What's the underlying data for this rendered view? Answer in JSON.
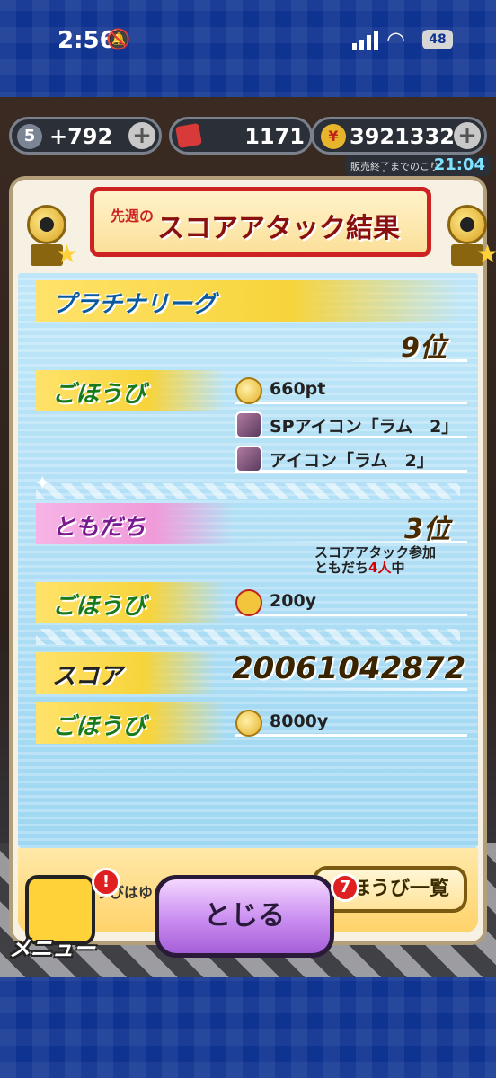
{
  "status_bar": {
    "time": "2:56",
    "battery": "48"
  },
  "hud": {
    "level": "5",
    "energy": "+792",
    "tickets": "1171",
    "money": "3921332",
    "sale_label": "販売終了までのこり",
    "sale_time": "21:04"
  },
  "result": {
    "banner_prefix": "先週の",
    "banner_title": "スコアアタック結果",
    "league_label": "プラチナリーグ",
    "league_rank": "9位",
    "reward_label": "ごほうび",
    "league_rewards": [
      {
        "icon": "coin-icon",
        "text": "660pt"
      },
      {
        "icon": "avatar-icon",
        "text": "SPアイコン「ラム　2」"
      },
      {
        "icon": "avatar-icon",
        "text": "アイコン「ラム　2」"
      }
    ],
    "friends_label": "ともだち",
    "friends_rank": "3位",
    "friends_note_line1": "スコアアタック参加",
    "friends_note_pre": "ともだち",
    "friends_note_count": "4人",
    "friends_note_post": "中",
    "friends_reward": "200y",
    "score_label": "スコア",
    "score_value": "20061042872",
    "score_reward": "8000y",
    "footer_note": "一部ごほうびはゆうびんに届きます",
    "reward_list_button": "ごほうび一覧"
  },
  "bottom": {
    "close_button": "とじる",
    "menu_label": "メニュー",
    "menu_badge": "!",
    "right_badge": "7"
  },
  "colors": {
    "frame_blue": "#0f3391",
    "close_button_purple": "#c98df0",
    "league_bar_yellow": "#f7d43b",
    "friends_bar_pink": "#f09bd9"
  }
}
